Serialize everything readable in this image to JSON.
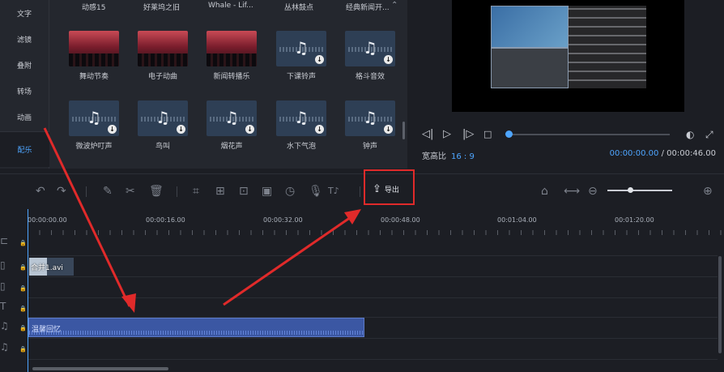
{
  "sidebar": {
    "items": [
      {
        "label": "文字"
      },
      {
        "label": "滤镜"
      },
      {
        "label": "叠附"
      },
      {
        "label": "转场"
      },
      {
        "label": "动画"
      }
    ],
    "active": {
      "label": "配乐"
    }
  },
  "library": {
    "header_row": [
      "动感15",
      "好莱坞之旧",
      "Whale - Lif...",
      "丛林鼓点",
      "经典新闻开..."
    ],
    "more_icon": "chevron-icon",
    "row1": [
      {
        "label": "舞动节奏",
        "thumb": "concert"
      },
      {
        "label": "电子动曲",
        "thumb": "concert"
      },
      {
        "label": "新闻转播乐",
        "thumb": "concert"
      },
      {
        "label": "下课铃声",
        "thumb": "note"
      },
      {
        "label": "格斗音效",
        "thumb": "note"
      }
    ],
    "row2": [
      {
        "label": "微波炉叮声",
        "thumb": "note"
      },
      {
        "label": "鸟叫",
        "thumb": "note"
      },
      {
        "label": "烟花声",
        "thumb": "note"
      },
      {
        "label": "水下气泡",
        "thumb": "note"
      },
      {
        "label": "钟声",
        "thumb": "note"
      }
    ]
  },
  "preview": {
    "ratio_label": "宽高比",
    "ratio_value": "16 : 9",
    "current_time": "00:00:00.00",
    "separator": "/",
    "total_time": "00:00:46.00",
    "progress": 0
  },
  "toolbar": {
    "export_label": "导出"
  },
  "timeline": {
    "ruler": [
      "00:00:00.00",
      "00:00:16.00",
      "00:00:32.00",
      "00:00:48.00",
      "00:01:04.00",
      "00:01:20.00"
    ],
    "video_clip_label": "合并1.avi",
    "audio_clip_label": "温馨回忆"
  },
  "colors": {
    "accent": "#4ea5ff",
    "highlight_box": "#e02a2a",
    "audio_clip": "#3b57a3",
    "background": "#1c1e24"
  }
}
